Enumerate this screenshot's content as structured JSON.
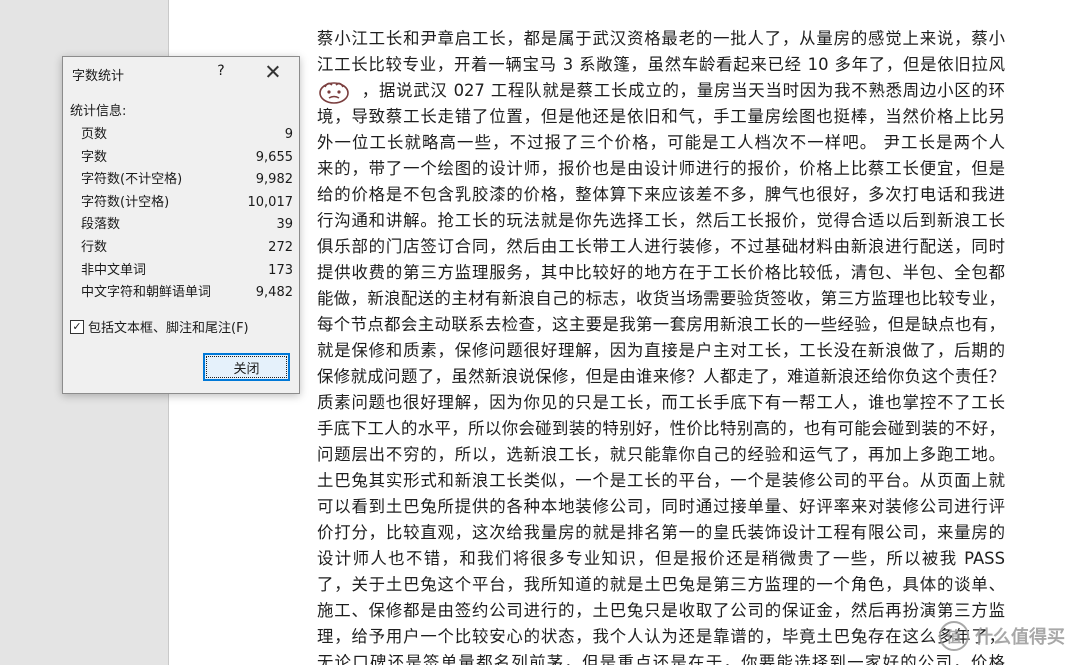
{
  "document": {
    "lines": [
      "",
      "蔡小江工长和尹章启工长，都是属于武汉资格最老的一批人了，从量房的感觉上来说，蔡小",
      "江工长比较专业，开着一辆宝马 3 系敞篷，虽然车龄看起来已经 10 多年了，但是依旧拉风",
      "，据说武汉 027 工程队就是蔡工长成立的，量房当天当时因为我不熟悉周边小区的环",
      "境，导致蔡工长走错了位置，但是他还是依旧和气，手工量房绘图也挺棒，当然价格上比另",
      "外一位工长就略高一些，不过报了三个价格，可能是工人档次不一样吧。 尹工长是两个人",
      "来的，带了一个绘图的设计师，报价也是由设计师进行的报价，价格上比蔡工长便宜，但是",
      "给的价格是不包含乳胶漆的价格，整体算下来应该差不多，脾气也很好，多次打电话和我进",
      "行沟通和讲解。抢工长的玩法就是你先选择工长，然后工长报价，觉得合适以后到新浪工长",
      "俱乐部的门店签订合同，然后由工长带工人进行装修，不过基础材料由新浪进行配送，同时",
      "提供收费的第三方监理服务，其中比较好的地方在于工长价格比较低，清包、半包、全包都",
      "能做，新浪配送的主材有新浪自己的标志，收货当场需要验货签收，第三方监理也比较专业，",
      "每个节点都会主动联系去检查，这主要是我第一套房用新浪工长的一些经验，但是缺点也有，",
      "就是保修和质素，保修问题很好理解，因为直接是户主对工长，工长没在新浪做了，后期的",
      "保修就成问题了，虽然新浪说保修，但是由谁来修？人都走了，难道新浪还给你负这个责任？",
      "质素问题也很好理解，因为你见的只是工长，而工长手底下有一帮工人，谁也掌控不了工长",
      "手底下工人的水平，所以你会碰到装的特别好，性价比特别高的，也有可能会碰到装的不好，",
      "问题层出不穷的，所以，选新浪工长，就只能靠你自己的经验和运气了，再加上多跑工地。",
      "土巴兔其实形式和新浪工长类似，一个是工长的平台，一个是装修公司的平台。从页面上就",
      "可以看到土巴兔所提供的各种本地装修公司，同时通过接单量、好评率来对装修公司进行评",
      "价打分，比较直观，这次给我量房的就是排名第一的皇氏装饰设计工程有限公司，来量房的",
      "设计师人也不错，和我们将很多专业知识，但是报价还是稍微贵了一些，所以被我 PASS",
      "了，关于土巴兔这个平台，我所知道的就是土巴兔是第三方监理的一个角色，具体的谈单、",
      "施工、保修都是由签约公司进行的，土巴兔只是收取了公司的保证金，然后再扮演第三方监",
      "理，给予用户一个比较安心的状态，我个人认为还是靠谱的，毕竟土巴兔存在这么多年了，",
      "无论口碑还是签单量都名列前茅，但是重点还是在于，你要能选择到一家好的公司，价格"
    ],
    "emoji_icon": "sticker-face-icon",
    "watermark": {
      "icon": "值",
      "text": "什么值得买"
    }
  },
  "dialog": {
    "title": "字数统计",
    "help_label": "?",
    "stats_heading": "统计信息:",
    "stats": [
      {
        "label": "页数",
        "value": "9"
      },
      {
        "label": "字数",
        "value": "9,655"
      },
      {
        "label": "字符数(不计空格)",
        "value": "9,982"
      },
      {
        "label": "字符数(计空格)",
        "value": "10,017"
      },
      {
        "label": "段落数",
        "value": "39"
      },
      {
        "label": "行数",
        "value": "272"
      },
      {
        "label": "非中文单词",
        "value": "173"
      },
      {
        "label": "中文字符和朝鲜语单词",
        "value": "9,482"
      }
    ],
    "include_checked": true,
    "include_label": "包括文本框、脚注和尾注(F)",
    "close_label": "关闭"
  }
}
